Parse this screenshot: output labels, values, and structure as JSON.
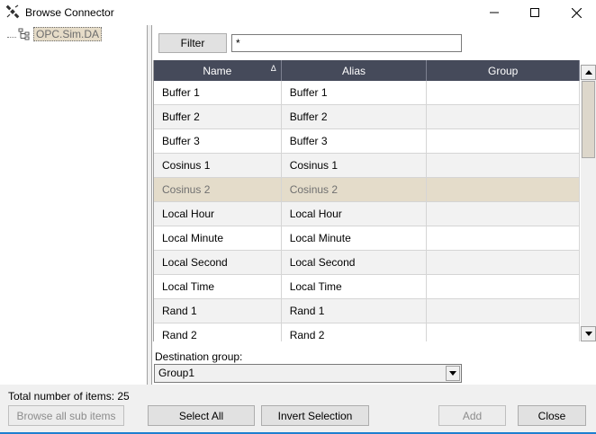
{
  "window": {
    "title": "Browse Connector",
    "icon": "satellite-connector-icon",
    "controls": [
      "minimize-icon",
      "maximize-icon",
      "close-icon"
    ]
  },
  "tree": {
    "root_label": "OPC.Sim.DA"
  },
  "filter": {
    "button_label": "Filter",
    "value": "*"
  },
  "grid": {
    "columns": [
      "Name",
      "Alias",
      "Group"
    ],
    "sort_indicator": "Δ",
    "rows": [
      {
        "name": "Buffer 1",
        "alias": "Buffer 1",
        "group": ""
      },
      {
        "name": "Buffer 2",
        "alias": "Buffer 2",
        "group": ""
      },
      {
        "name": "Buffer 3",
        "alias": "Buffer 3",
        "group": ""
      },
      {
        "name": "Cosinus 1",
        "alias": "Cosinus 1",
        "group": ""
      },
      {
        "name": "Cosinus 2",
        "alias": "Cosinus 2",
        "group": ""
      },
      {
        "name": "Local Hour",
        "alias": "Local Hour",
        "group": ""
      },
      {
        "name": "Local Minute",
        "alias": "Local Minute",
        "group": ""
      },
      {
        "name": "Local Second",
        "alias": "Local Second",
        "group": ""
      },
      {
        "name": "Local Time",
        "alias": "Local Time",
        "group": ""
      },
      {
        "name": "Rand 1",
        "alias": "Rand 1",
        "group": ""
      },
      {
        "name": "Rand 2",
        "alias": "Rand 2",
        "group": ""
      }
    ],
    "selected_row_index": 4
  },
  "destination": {
    "label": "Destination group:",
    "value": "Group1"
  },
  "footer": {
    "total_text": "Total number of items: 25",
    "browse_all_label": "Browse all sub items",
    "select_all_label": "Select All",
    "invert_selection_label": "Invert Selection",
    "add_label": "Add",
    "close_label": "Close"
  },
  "colors": {
    "header_bg": "#454a5a",
    "selected_row_bg": "#e4dcca",
    "accent_line": "#1e7fd0"
  }
}
